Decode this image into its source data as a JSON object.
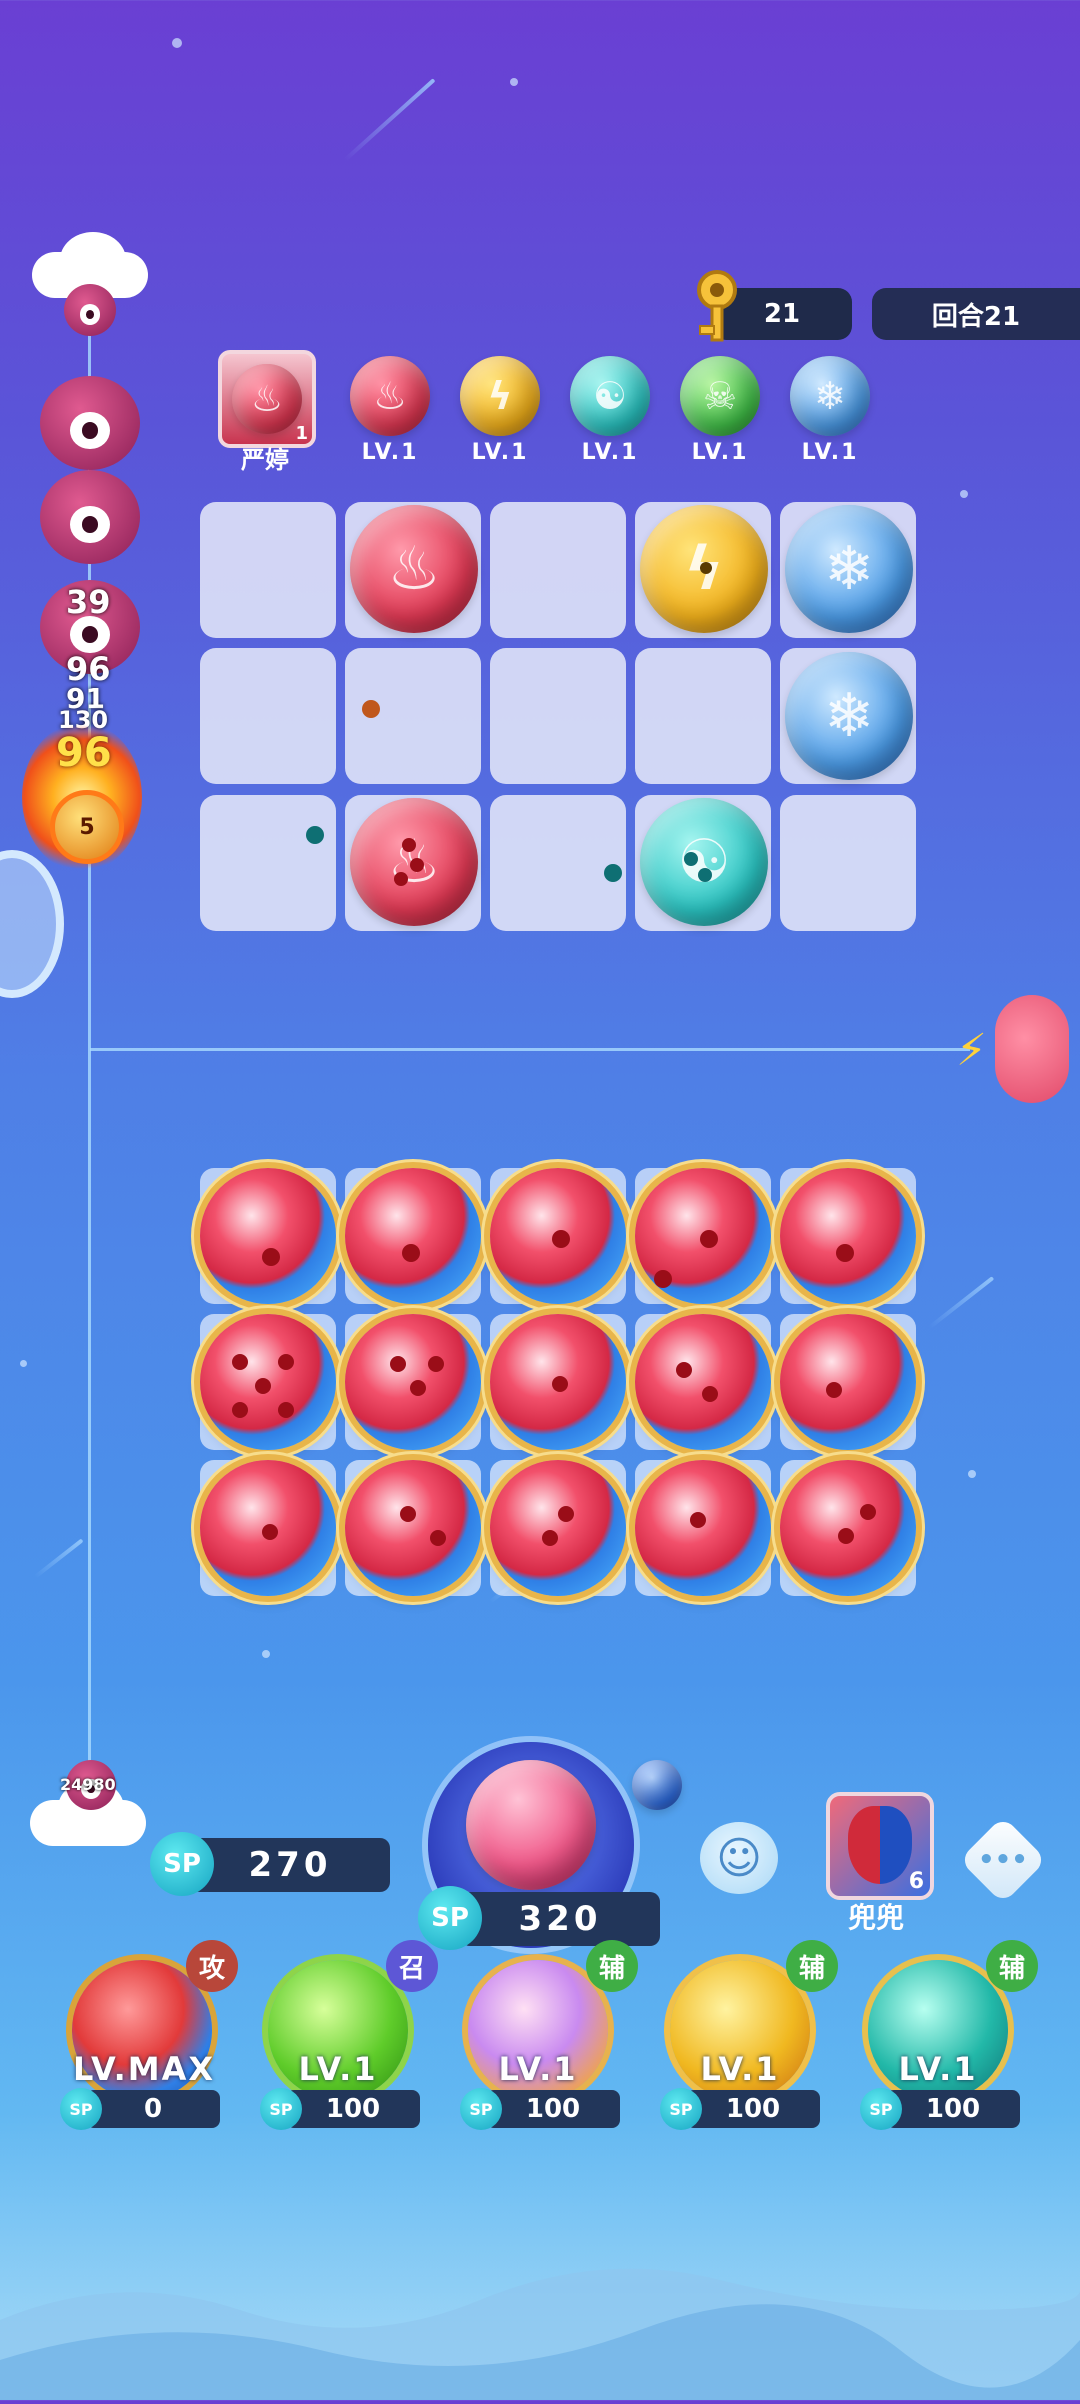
{
  "header": {
    "key_count": "21",
    "round_label": "回合21"
  },
  "element_bar": {
    "character": {
      "name": "严婷",
      "badge": "1"
    },
    "levels": [
      "LV.1",
      "LV.1",
      "LV.1",
      "LV.1",
      "LV.1"
    ]
  },
  "enemy_track": {
    "damage_numbers": [
      "39",
      "96",
      "91",
      "130",
      "96"
    ],
    "boss_label": "5"
  },
  "bottom_track": {
    "score": "24980"
  },
  "player": {
    "sp_left": "270",
    "sp_launcher": "320",
    "ally": {
      "name": "兜兜",
      "badge": "6"
    }
  },
  "skills": [
    {
      "tag": "攻",
      "level": "LV.MAX",
      "sp": "0"
    },
    {
      "tag": "召",
      "level": "LV.1",
      "sp": "100"
    },
    {
      "tag": "辅",
      "level": "LV.1",
      "sp": "100"
    },
    {
      "tag": "辅",
      "level": "LV.1",
      "sp": "100"
    },
    {
      "tag": "辅",
      "level": "LV.1",
      "sp": "100"
    }
  ],
  "sp_label": "SP",
  "colors": {
    "fire": "#e23a55",
    "thunder": "#f3b21c",
    "wind": "#2cc6c4",
    "poison": "#43c24a",
    "ice": "#4d9de8",
    "tag_attack": "#b8473a",
    "tag_summon": "#5d57d6",
    "tag_support": "#3fae45"
  }
}
